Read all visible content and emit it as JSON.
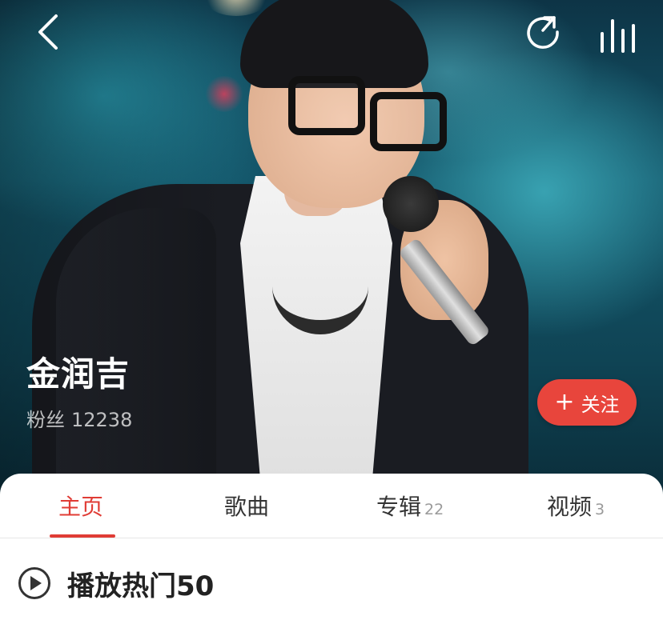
{
  "header": {
    "back_icon": "chevron-left-icon",
    "share_icon": "share-arrow-icon",
    "playing_icon": "equalizer-bars-icon"
  },
  "artist": {
    "name": "金润吉",
    "fans_label": "粉丝",
    "fans_count": "12238",
    "follow_label": "关注",
    "follow_icon": "+",
    "accent_color": "#e8453c"
  },
  "tabs": [
    {
      "label": "主页",
      "count": "",
      "active": true
    },
    {
      "label": "歌曲",
      "count": "",
      "active": false
    },
    {
      "label": "专辑",
      "count": "22",
      "active": false
    },
    {
      "label": "视频",
      "count": "3",
      "active": false
    }
  ],
  "play_all": {
    "label": "播放热门50",
    "icon": "play-circle-icon"
  }
}
